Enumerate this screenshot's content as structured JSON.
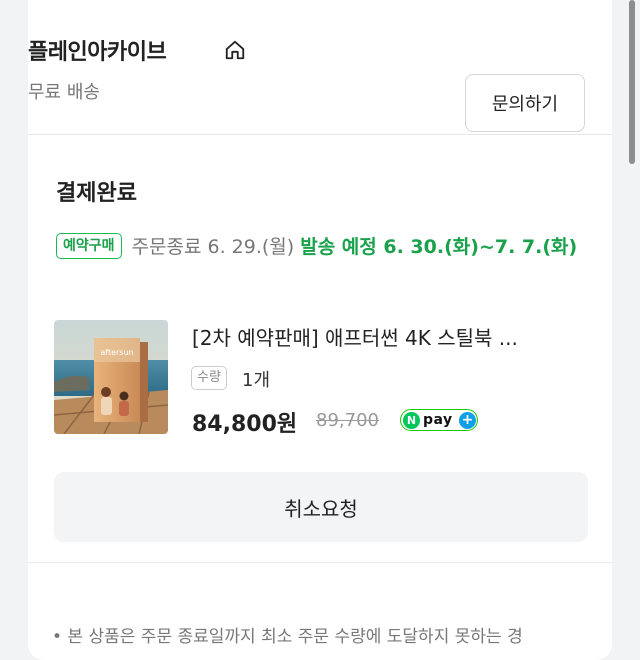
{
  "store": {
    "name": "플레인아카이브",
    "shipping": "무료 배송",
    "inquiry_label": "문의하기"
  },
  "order": {
    "status": "결제완료",
    "badge": "예약구매",
    "order_end": "주문종료 6. 29.(월)",
    "ship_plan": "발송 예정 6. 30.(화)~7. 7.(화)"
  },
  "product": {
    "title": "[2차 예약판매] 애프터썬 4K 스틸북 ...",
    "qty_label": "수량",
    "qty_value": "1개",
    "price": "84,800원",
    "original_price": "89,700",
    "npay_text": "pay",
    "npay_n": "N",
    "npay_plus": "+",
    "thumbnail_text": "aftersun"
  },
  "actions": {
    "cancel_label": "취소요청"
  },
  "notice": {
    "text": "• 본 상품은 주문 종료일까지 최소 주문 수량에 도달하지 못하는 경"
  },
  "colors": {
    "accent_green": "#1aa14b",
    "npay_green": "#03c75a",
    "npay_blue": "#11a0e8"
  },
  "icons": {
    "store_home": "home-icon"
  }
}
